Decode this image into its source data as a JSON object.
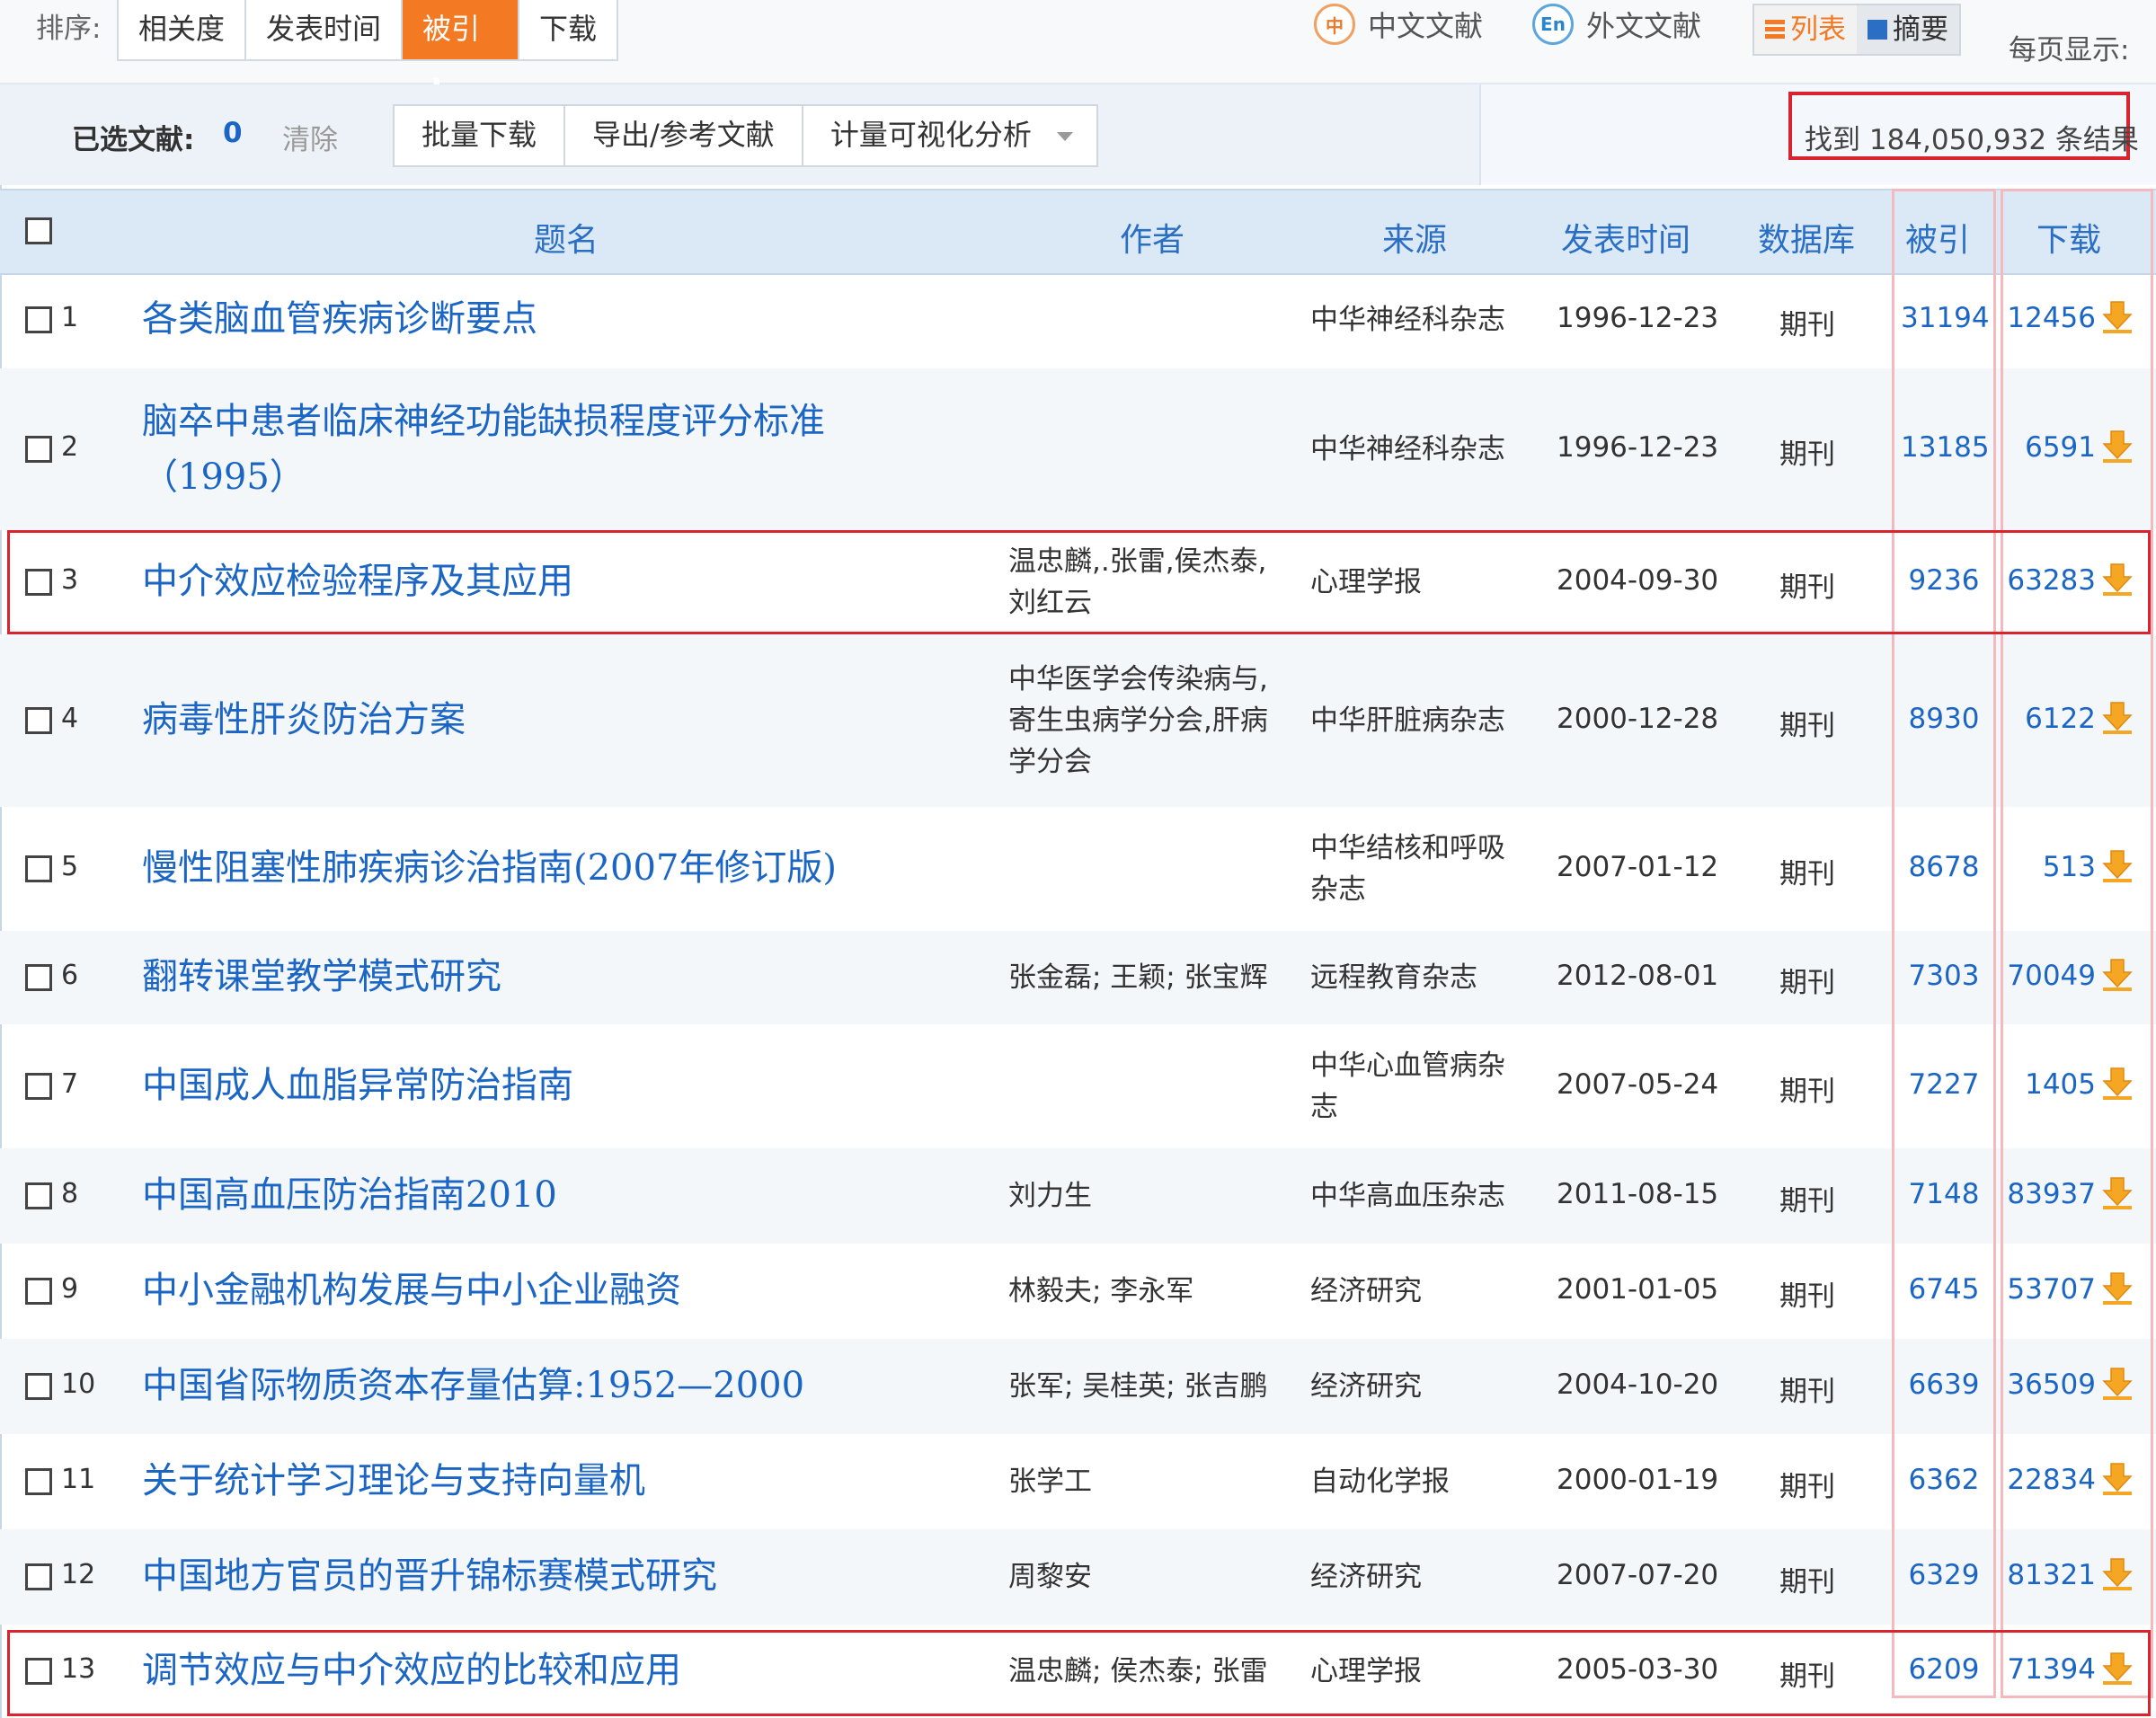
{
  "sort": {
    "label": "排序:",
    "options": [
      "相关度",
      "发表时间",
      "被引",
      "下载"
    ],
    "active_index": 2
  },
  "language": {
    "zh_label": "中文文献",
    "en_label": "外文文献",
    "zh_badge": "中",
    "en_badge": "En"
  },
  "view": {
    "list_label": "列表",
    "abstract_label": "摘要"
  },
  "per_page_label": "每页显示:",
  "selection": {
    "label": "已选文献:",
    "count": "0",
    "clear": "清除"
  },
  "actions": [
    "批量下载",
    "导出/参考文献",
    "计量可视化分析"
  ],
  "results_text": "找到 184,050,932 条结果",
  "table": {
    "headers": {
      "title": "题名",
      "author": "作者",
      "source": "来源",
      "date": "发表时间",
      "db": "数据库",
      "cited": "被引",
      "download": "下载"
    },
    "rows": [
      {
        "num": "1",
        "title": "各类脑血管疾病诊断要点",
        "author": "",
        "source": "中华神经科杂志",
        "date": "1996-12-23",
        "db": "期刊",
        "cited": "31194",
        "download": "12456"
      },
      {
        "num": "2",
        "title": "脑卒中患者临床神经功能缺损程度评分标准（1995）",
        "author": "",
        "source": "中华神经科杂志",
        "date": "1996-12-23",
        "db": "期刊",
        "cited": "13185",
        "download": "6591"
      },
      {
        "num": "3",
        "title": "中介效应检验程序及其应用",
        "author": "温忠麟,.张雷,侯杰泰,刘红云",
        "source": "心理学报",
        "date": "2004-09-30",
        "db": "期刊",
        "cited": "9236",
        "download": "63283"
      },
      {
        "num": "4",
        "title": "病毒性肝炎防治方案",
        "author": "中华医学会传染病与,寄生虫病学分会,肝病学分会",
        "source": "中华肝脏病杂志",
        "date": "2000-12-28",
        "db": "期刊",
        "cited": "8930",
        "download": "6122"
      },
      {
        "num": "5",
        "title": "慢性阻塞性肺疾病诊治指南(2007年修订版)",
        "author": "",
        "source": "中华结核和呼吸杂志",
        "date": "2007-01-12",
        "db": "期刊",
        "cited": "8678",
        "download": "513"
      },
      {
        "num": "6",
        "title": "翻转课堂教学模式研究",
        "author": "张金磊; 王颖; 张宝辉",
        "source": "远程教育杂志",
        "date": "2012-08-01",
        "db": "期刊",
        "cited": "7303",
        "download": "70049"
      },
      {
        "num": "7",
        "title": "中国成人血脂异常防治指南",
        "author": "",
        "source": "中华心血管病杂志",
        "date": "2007-05-24",
        "db": "期刊",
        "cited": "7227",
        "download": "1405"
      },
      {
        "num": "8",
        "title": "中国高血压防治指南2010",
        "author": "刘力生",
        "source": "中华高血压杂志",
        "date": "2011-08-15",
        "db": "期刊",
        "cited": "7148",
        "download": "83937"
      },
      {
        "num": "9",
        "title": "中小金融机构发展与中小企业融资",
        "author": "林毅夫; 李永军",
        "source": "经济研究",
        "date": "2001-01-05",
        "db": "期刊",
        "cited": "6745",
        "download": "53707"
      },
      {
        "num": "10",
        "title": "中国省际物质资本存量估算:1952—2000",
        "author": "张军; 吴桂英; 张吉鹏",
        "source": "经济研究",
        "date": "2004-10-20",
        "db": "期刊",
        "cited": "6639",
        "download": "36509"
      },
      {
        "num": "11",
        "title": "关于统计学习理论与支持向量机",
        "author": "张学工",
        "source": "自动化学报",
        "date": "2000-01-19",
        "db": "期刊",
        "cited": "6362",
        "download": "22834"
      },
      {
        "num": "12",
        "title": "中国地方官员的晋升锦标赛模式研究",
        "author": "周黎安",
        "source": "经济研究",
        "date": "2007-07-20",
        "db": "期刊",
        "cited": "6329",
        "download": "81321"
      },
      {
        "num": "13",
        "title": "调节效应与中介效应的比较和应用",
        "author": "温忠麟; 侯杰泰; 张雷",
        "source": "心理学报",
        "date": "2005-03-30",
        "db": "期刊",
        "cited": "6209",
        "download": "71394"
      }
    ]
  },
  "colors": {
    "accent": "#f37a22",
    "link": "#1b66c5",
    "highlight": "#d9232e",
    "header_bg": "#dbe8f6",
    "download_icon": "#f5a623"
  },
  "icons": {
    "download": "download-icon",
    "zh": "chinese-literature-icon",
    "en": "foreign-literature-icon"
  }
}
